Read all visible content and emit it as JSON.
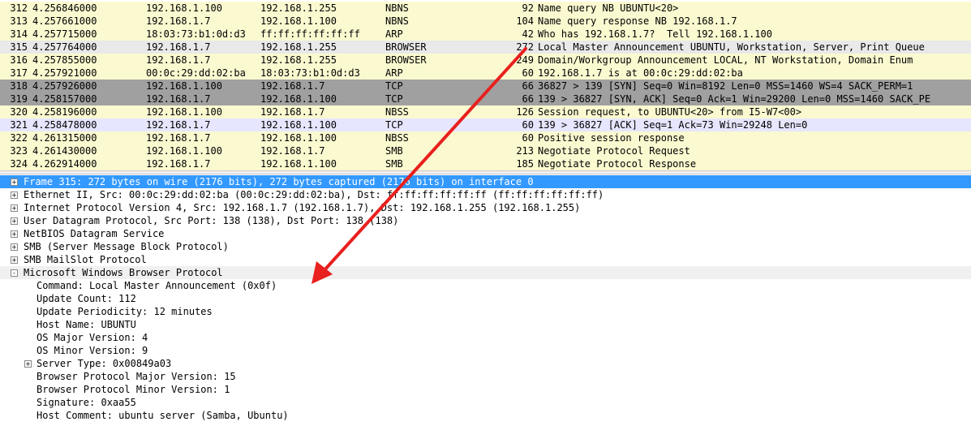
{
  "colors": {
    "nbns_bg": "#fefdd6",
    "arp_bg": "#fefdd6",
    "browser_bg": "#fefdd6",
    "tcp_syn_bg": "#a0a0a0",
    "tcp_bg": "#e7e6ff",
    "nbss_bg": "#fefdd6",
    "smb_bg": "#fefdd6",
    "selected_bg": "#3399ff",
    "arrow": "#e8201e"
  },
  "packets": [
    {
      "no": "312",
      "time": "4.256846000",
      "src": "192.168.1.100",
      "dst": "192.168.1.255",
      "proto": "NBNS",
      "len": "92",
      "info": "Name query NB UBUNTU<20>",
      "bg": "#fbf9d0"
    },
    {
      "no": "313",
      "time": "4.257661000",
      "src": "192.168.1.7",
      "dst": "192.168.1.100",
      "proto": "NBNS",
      "len": "104",
      "info": "Name query response NB 192.168.1.7",
      "bg": "#fbf9d0"
    },
    {
      "no": "314",
      "time": "4.257715000",
      "src": "18:03:73:b1:0d:d3",
      "dst": "ff:ff:ff:ff:ff:ff",
      "proto": "ARP",
      "len": "42",
      "info": "Who has 192.168.1.7?  Tell 192.168.1.100",
      "bg": "#fbf9d0"
    },
    {
      "no": "315",
      "time": "4.257764000",
      "src": "192.168.1.7",
      "dst": "192.168.1.255",
      "proto": "BROWSER",
      "len": "272",
      "info": "Local Master Announcement UBUNTU, Workstation, Server, Print Queue",
      "bg": "#e9e9e9"
    },
    {
      "no": "316",
      "time": "4.257855000",
      "src": "192.168.1.7",
      "dst": "192.168.1.255",
      "proto": "BROWSER",
      "len": "249",
      "info": "Domain/Workgroup Announcement LOCAL, NT Workstation, Domain Enum",
      "bg": "#fbf9d0"
    },
    {
      "no": "317",
      "time": "4.257921000",
      "src": "00:0c:29:dd:02:ba",
      "dst": "18:03:73:b1:0d:d3",
      "proto": "ARP",
      "len": "60",
      "info": "192.168.1.7 is at 00:0c:29:dd:02:ba",
      "bg": "#fbf9d0"
    },
    {
      "no": "318",
      "time": "4.257926000",
      "src": "192.168.1.100",
      "dst": "192.168.1.7",
      "proto": "TCP",
      "len": "66",
      "info": "36827 > 139 [SYN] Seq=0 Win=8192 Len=0 MSS=1460 WS=4 SACK_PERM=1",
      "bg": "#a0a0a0"
    },
    {
      "no": "319",
      "time": "4.258157000",
      "src": "192.168.1.7",
      "dst": "192.168.1.100",
      "proto": "TCP",
      "len": "66",
      "info": "139 > 36827 [SYN, ACK] Seq=0 Ack=1 Win=29200 Len=0 MSS=1460 SACK_PE",
      "bg": "#a0a0a0"
    },
    {
      "no": "320",
      "time": "4.258196000",
      "src": "192.168.1.100",
      "dst": "192.168.1.7",
      "proto": "NBSS",
      "len": "126",
      "info": "Session request, to UBUNTU<20> from I5-W7<00>",
      "bg": "#fbf9d0"
    },
    {
      "no": "321",
      "time": "4.258478000",
      "src": "192.168.1.7",
      "dst": "192.168.1.100",
      "proto": "TCP",
      "len": "60",
      "info": "139 > 36827 [ACK] Seq=1 Ack=73 Win=29248 Len=0",
      "bg": "#e7e6ff"
    },
    {
      "no": "322",
      "time": "4.261315000",
      "src": "192.168.1.7",
      "dst": "192.168.1.100",
      "proto": "NBSS",
      "len": "60",
      "info": "Positive session response",
      "bg": "#fbf9d0"
    },
    {
      "no": "323",
      "time": "4.261430000",
      "src": "192.168.1.100",
      "dst": "192.168.1.7",
      "proto": "SMB",
      "len": "213",
      "info": "Negotiate Protocol Request",
      "bg": "#fbf9d0"
    },
    {
      "no": "324",
      "time": "4.262914000",
      "src": "192.168.1.7",
      "dst": "192.168.1.100",
      "proto": "SMB",
      "len": "185",
      "info": "Negotiate Protocol Response",
      "bg": "#fbf9d0"
    }
  ],
  "details": [
    {
      "text": "Frame 315: 272 bytes on wire (2176 bits), 272 bytes captured (2176 bits) on interface 0",
      "expander": "+",
      "indent": 0,
      "selected": true
    },
    {
      "text": "Ethernet II, Src: 00:0c:29:dd:02:ba (00:0c:29:dd:02:ba), Dst: ff:ff:ff:ff:ff:ff (ff:ff:ff:ff:ff:ff)",
      "expander": "+",
      "indent": 0
    },
    {
      "text": "Internet Protocol Version 4, Src: 192.168.1.7 (192.168.1.7), Dst: 192.168.1.255 (192.168.1.255)",
      "expander": "+",
      "indent": 0
    },
    {
      "text": "User Datagram Protocol, Src Port: 138 (138), Dst Port: 138 (138)",
      "expander": "+",
      "indent": 0
    },
    {
      "text": "NetBIOS Datagram Service",
      "expander": "+",
      "indent": 0
    },
    {
      "text": "SMB (Server Message Block Protocol)",
      "expander": "+",
      "indent": 0
    },
    {
      "text": "SMB MailSlot Protocol",
      "expander": "+",
      "indent": 0
    },
    {
      "text": "Microsoft Windows Browser Protocol",
      "expander": "-",
      "indent": 0,
      "header": true
    },
    {
      "text": "Command: Local Master Announcement (0x0f)",
      "indent": 1
    },
    {
      "text": "Update Count: 112",
      "indent": 1
    },
    {
      "text": "Update Periodicity: 12 minutes",
      "indent": 1
    },
    {
      "text": "Host Name: UBUNTU",
      "indent": 1
    },
    {
      "text": "OS Major Version: 4",
      "indent": 1
    },
    {
      "text": "OS Minor Version: 9",
      "indent": 1
    },
    {
      "text": "Server Type: 0x00849a03",
      "expander": "+",
      "indent": 1
    },
    {
      "text": "Browser Protocol Major Version: 15",
      "indent": 1
    },
    {
      "text": "Browser Protocol Minor Version: 1",
      "indent": 1
    },
    {
      "text": "Signature: 0xaa55",
      "indent": 1
    },
    {
      "text": "Host Comment: ubuntu server (Samba, Ubuntu)",
      "indent": 1
    }
  ]
}
